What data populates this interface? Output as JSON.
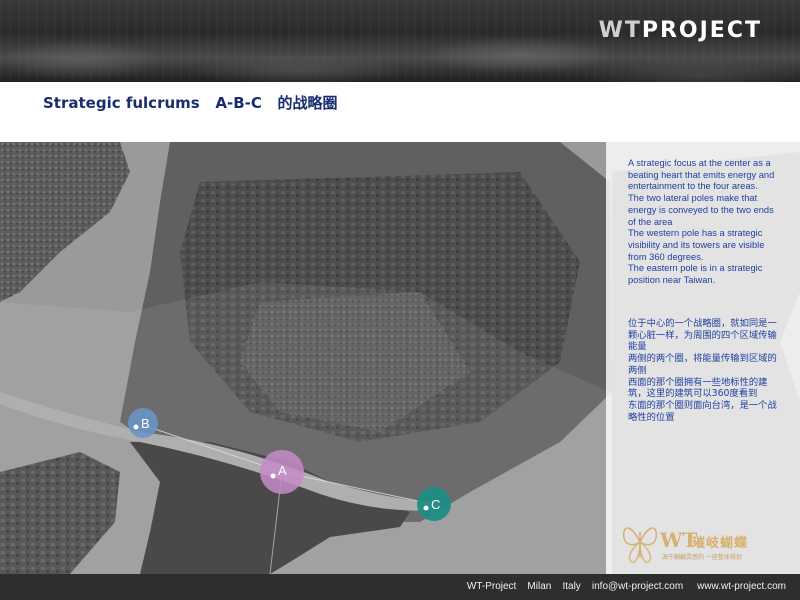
{
  "header": {
    "logo_prefix": "WT",
    "logo_suffix": "PROJECT"
  },
  "title": "Strategic fulcrums   A-B-C   的战略圈",
  "markers": [
    {
      "label": "B",
      "color": "#6a95c8"
    },
    {
      "label": "A",
      "color": "#c58bc9"
    },
    {
      "label": "C",
      "color": "#1f8d84"
    }
  ],
  "info": {
    "en": [
      "A strategic focus at the center as a beating heart  that emits energy and entertainment to the four areas.",
      "The two lateral poles make that energy is conveyed to the two ends of the area",
      "The western pole has a strategic visibility and its towers are visible from 360 degrees.",
      "The eastern pole is in a strategic position near Taiwan."
    ],
    "zh": [
      "位于中心的一个战略圈，就如同是一颗心脏一样，为周围的四个区域传输能量",
      "两侧的两个圈，将能量传输到区域的两侧",
      "西面的那个圈拥有一些地标性的建筑，这里的建筑可以360度看到",
      "东面的那个圈则面向台湾，是一个战略性的位置"
    ]
  },
  "brand": {
    "wt": "WT",
    "cn": "璀岐蝴蝶",
    "sub": "源于翩翩灵感的 一座整体规划"
  },
  "footer": {
    "text": "WT-Project    Milan    Italy    info@wt-project.com     www.wt-project.com"
  }
}
